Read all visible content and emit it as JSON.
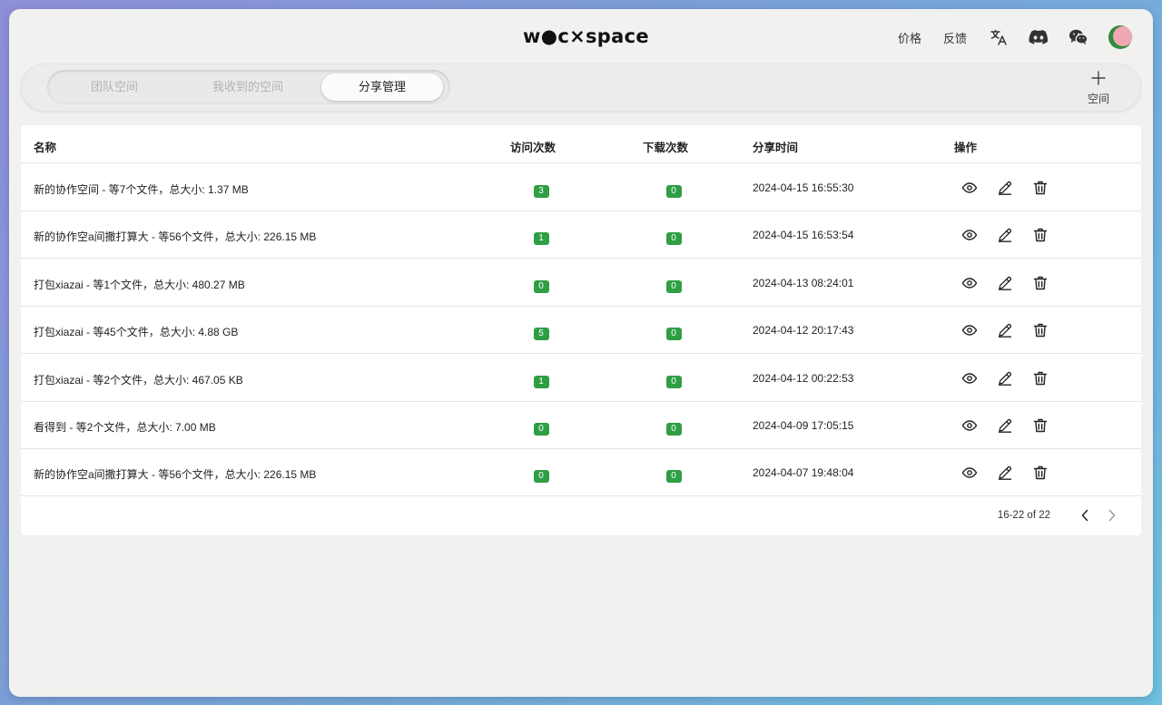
{
  "app": {
    "logo": "w●c×space"
  },
  "nav": {
    "links": [
      "价格",
      "反馈"
    ],
    "icons": [
      "translate-icon",
      "discord-icon",
      "wechat-icon"
    ]
  },
  "tabs": [
    "团队空间",
    "我收到的空间",
    "分享管理"
  ],
  "active_tab": "分享管理",
  "add_space": {
    "icon": "plus-icon",
    "label": "空间"
  },
  "table": {
    "columns": {
      "name": "名称",
      "visits": "访问次数",
      "downloads": "下载次数",
      "share_time": "分享时间",
      "actions": "操作"
    },
    "rows": [
      {
        "name": "新的协作空间 - 等7个文件，总大小: 1.37 MB",
        "visits": "3",
        "downloads": "0",
        "share_time": "2024-04-15 16:55:30"
      },
      {
        "name": "新的协作空a间撒打算大 - 等56个文件，总大小: 226.15 MB",
        "visits": "1",
        "downloads": "0",
        "share_time": "2024-04-15 16:53:54"
      },
      {
        "name": "打包xiazai - 等1个文件，总大小: 480.27 MB",
        "visits": "0",
        "downloads": "0",
        "share_time": "2024-04-13 08:24:01"
      },
      {
        "name": "打包xiazai - 等45个文件，总大小: 4.88 GB",
        "visits": "5",
        "downloads": "0",
        "share_time": "2024-04-12 20:17:43"
      },
      {
        "name": "打包xiazai - 等2个文件，总大小: 467.05 KB",
        "visits": "1",
        "downloads": "0",
        "share_time": "2024-04-12 00:22:53"
      },
      {
        "name": "看得到 - 等2个文件，总大小: 7.00 MB",
        "visits": "0",
        "downloads": "0",
        "share_time": "2024-04-09 17:05:15"
      },
      {
        "name": "新的协作空a间撒打算大 - 等56个文件，总大小: 226.15 MB",
        "visits": "0",
        "downloads": "0",
        "share_time": "2024-04-07 19:48:04"
      }
    ],
    "row_actions": [
      "eye-icon",
      "edit-icon",
      "trash-icon"
    ]
  },
  "pagination": {
    "text": "16-22 of 22"
  },
  "colors": {
    "badge": "#2f9e44",
    "background": "#f1f1ef"
  }
}
